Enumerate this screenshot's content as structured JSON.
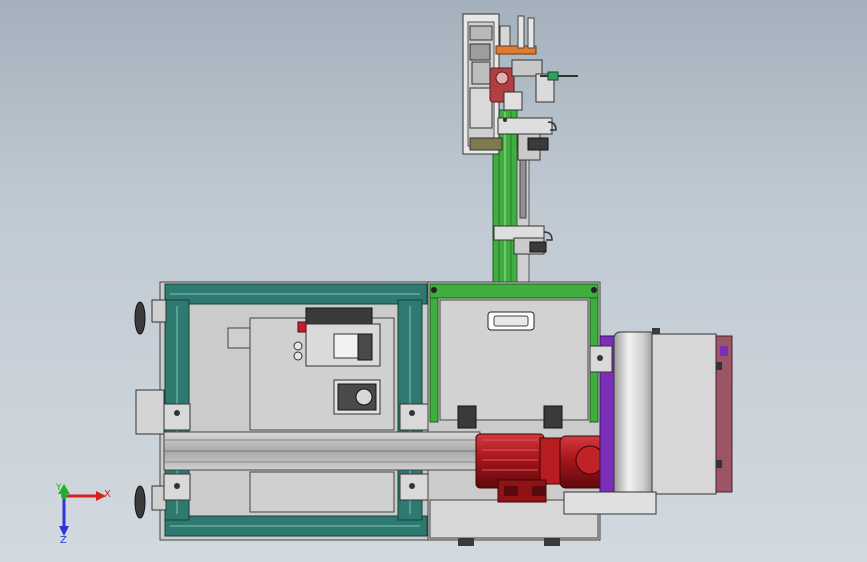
{
  "triad": {
    "x_label": "X",
    "y_label": "Y",
    "z_label": "Z",
    "x_color": "#d62020",
    "y_color": "#1fb02a",
    "z_color": "#2c37d6"
  },
  "colors": {
    "frame_teal": "#2f7a70",
    "frame_green": "#3fae3f",
    "panel_grey": "#c9c9c9",
    "motor_red": "#b1171b",
    "purple_trim": "#7b2fb8",
    "maroon_panel": "#9c5565"
  }
}
